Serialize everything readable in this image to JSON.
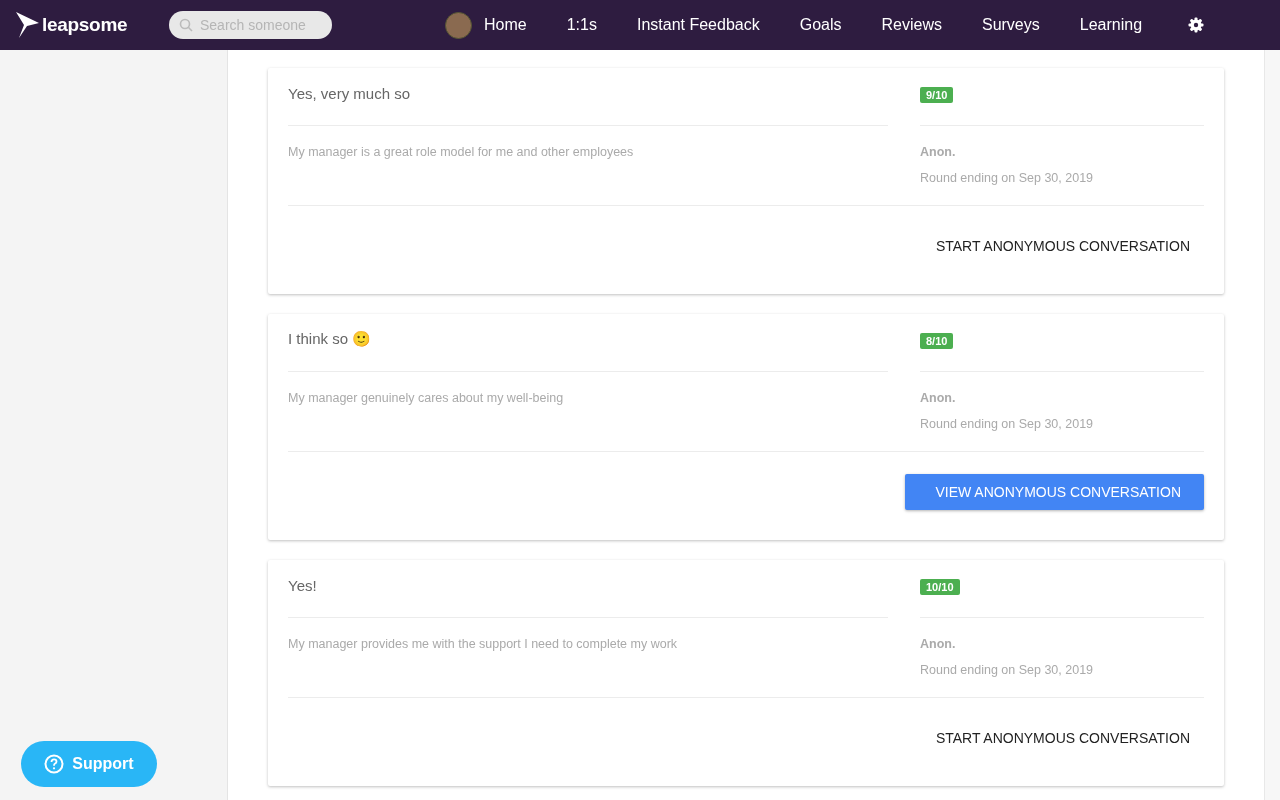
{
  "nav": {
    "logo": "leapsome",
    "search": {
      "placeholder": "Search someone"
    },
    "items": [
      {
        "label": "Home",
        "avatar": true
      },
      {
        "label": "1:1s",
        "avatar": false
      },
      {
        "label": "Instant Feedback",
        "avatar": false
      },
      {
        "label": "Goals",
        "avatar": false
      },
      {
        "label": "Reviews",
        "avatar": false
      },
      {
        "label": "Surveys",
        "avatar": false
      },
      {
        "label": "Learning",
        "avatar": false
      }
    ]
  },
  "cards": [
    {
      "answer": "Yes, very much so",
      "score": "9/10",
      "question": "My manager is a great role model for me and other employees",
      "author": "Anon.",
      "round": "Round ending on Sep 30, 2019",
      "button": {
        "label": "START ANONYMOUS CONVERSATION",
        "kind": "flat"
      }
    },
    {
      "answer": "I think so 🙂",
      "score": "8/10",
      "question": "My manager genuinely cares about my well-being",
      "author": "Anon.",
      "round": "Round ending on Sep 30, 2019",
      "button": {
        "label": "VIEW ANONYMOUS CONVERSATION",
        "kind": "raised"
      }
    },
    {
      "answer": "Yes!",
      "score": "10/10",
      "question": "My manager provides me with the support I need to complete my work",
      "author": "Anon.",
      "round": "Round ending on Sep 30, 2019",
      "button": {
        "label": "START ANONYMOUS CONVERSATION",
        "kind": "flat"
      }
    }
  ],
  "support": {
    "label": "Support"
  }
}
